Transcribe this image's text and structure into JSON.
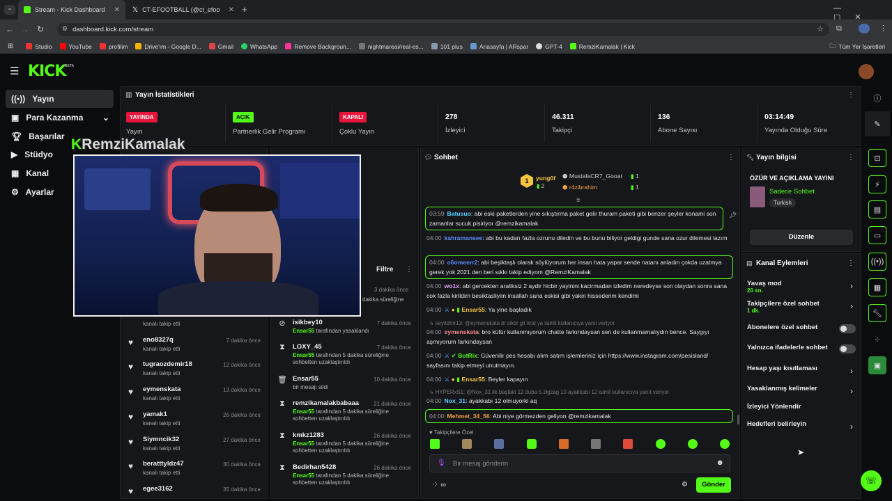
{
  "browser": {
    "tabs": [
      {
        "title": "Stream - Kick Dashboard",
        "icon": "kick-icon"
      },
      {
        "title": "CT-EFOOTBALL (@ct_efootball)",
        "icon": "x-icon"
      }
    ],
    "url": "dashboard.kick.com/stream",
    "bookmarks": [
      "Studio",
      "YouTube",
      "profilim",
      "Drive'ım - Google D...",
      "Gmail",
      "WhatsApp",
      "Remove Backgroun...",
      "nightmareai/real-es...",
      "101 plus",
      "Anasayfa | ARspar",
      "GPT-4",
      "RemziKamalak | Kick"
    ],
    "all_bookmarks": "Tüm Yer İşaretleri"
  },
  "brand": {
    "logo": "KICK",
    "beta": "BETA",
    "accent": "#53fc18"
  },
  "sidebar": {
    "items": [
      {
        "label": "Yayın",
        "icon": "broadcast-icon"
      },
      {
        "label": "Para Kazanma",
        "icon": "money-icon"
      },
      {
        "label": "Başarılar",
        "icon": "trophy-icon"
      },
      {
        "label": "Stüdyo",
        "icon": "camera-icon"
      },
      {
        "label": "Kanal",
        "icon": "tv-icon"
      },
      {
        "label": "Ayarlar",
        "icon": "gear-icon"
      }
    ]
  },
  "stats": {
    "title": "Yayın İstatistikleri",
    "cards": [
      {
        "badge": "YAYINDA",
        "label": "Yayın"
      },
      {
        "badge": "AÇIK",
        "label": "Partnerlik Gelir Programı"
      },
      {
        "badge": "KAPALI",
        "label": "Çoklu Yayın"
      },
      {
        "value": "278",
        "label": "İzleyici"
      },
      {
        "value": "46.311",
        "label": "Takipçi"
      },
      {
        "value": "136",
        "label": "Abone Sayısı"
      },
      {
        "value": "03:14:49",
        "label": "Yayında Olduğu Süre"
      }
    ]
  },
  "overlay": {
    "streamer": "RemziKamalak"
  },
  "followers": [
    {
      "name": "",
      "sub": "kanalı takip etti",
      "time": ""
    },
    {
      "name": "eno8327q",
      "sub": "kanalı takip etti",
      "time": "7 dakika önce"
    },
    {
      "name": "tugraozdemir18",
      "sub": "kanalı takip etti",
      "time": "12 dakika önce"
    },
    {
      "name": "eymenskata",
      "sub": "kanalı takip etti",
      "time": "13 dakika önce"
    },
    {
      "name": "yamak1",
      "sub": "kanalı takip etti",
      "time": "26 dakika önce"
    },
    {
      "name": "Siymncik32",
      "sub": "kanalı takip etti",
      "time": "27 dakika önce"
    },
    {
      "name": "beratttyldz47",
      "sub": "kanalı takip etti",
      "time": "30 dakika önce"
    },
    {
      "name": "egee3162",
      "sub": "",
      "time": "35 dakika önce"
    }
  ],
  "modlog": {
    "filter": "Filtre",
    "top": {
      "sub": "dakika süreliğine",
      "time": "3 dakika önce"
    },
    "rows": [
      {
        "icon": "ban-icon",
        "name": "isikbey10",
        "actor": "Ensar55",
        "action": "tarafından yasaklandı",
        "time": "7 dakika önce"
      },
      {
        "icon": "hourglass-icon",
        "name": "LOXY_45",
        "actor": "Ensar55",
        "action": "tarafından 5 dakika süreliğine sohbetten uzaklaştırıldı",
        "time": "7 dakika önce"
      },
      {
        "icon": "trash-icon",
        "name": "Ensar55",
        "actor": "",
        "action": "bir mesajı sildi",
        "time": "10 dakika önce"
      },
      {
        "icon": "hourglass-icon",
        "name": "remzikamalakbabaaa",
        "actor": "Ensar55",
        "action": "tarafından 5 dakika süreliğine sohbetten uzaklaştırıldı",
        "time": "21 dakika önce"
      },
      {
        "icon": "hourglass-icon",
        "name": "kmkz1283",
        "actor": "Ensar55",
        "action": "tarafından 5 dakika süreliğine sohbetten uzaklaştırıldı",
        "time": "26 dakika önce"
      },
      {
        "icon": "hourglass-icon",
        "name": "Bedirhan5428",
        "actor": "Ensar55",
        "action": "tarafından 5 dakika süreliğine sohbetten uzaklaştırıldı",
        "time": "26 dakika önce"
      }
    ]
  },
  "chat": {
    "title": "Sohbet",
    "leaders": [
      {
        "rank": "1",
        "name": "yung0f",
        "count": "2"
      },
      {
        "name": "MustafaCR7_Gooat",
        "count": "1"
      },
      {
        "name": "r4zibrahim",
        "count": "1"
      }
    ],
    "messages": [
      {
        "time": "03:59",
        "user": "Batusuo",
        "color": "#5bd1ff",
        "text": "abi eski paketlerden yine sıkıştırma paket gelir thuram paketi gibi benzer şeyler konami son zamanlar sucuk pisiriyor @remzikamalak",
        "hl": true
      },
      {
        "time": "04:00",
        "user": "kahramansee",
        "color": "#5b8cff",
        "text": "abi bu kadarı fazla ozrunu diledin ve bu bunu biliyor geldigi gunde sana ozur dilemesi lazım",
        "hl": false
      },
      {
        "time": "04:00",
        "user": "o6omeerr2",
        "color": "#5b8cff",
        "text": "abi beşiktaşlı olarak söylüyorum her insan hata yapar sende natanı anladın çokda uzatmya gerek yok 2021 den beri sıkkı takip ediyom @RemziKamalak",
        "hl": true
      },
      {
        "time": "04:00",
        "user": "wo1x",
        "color": "#e0a3ff",
        "text": "abi gercekten araliksiz 2 aydir hicbir yayinini kacirmadan izledim neredeyse son olaydan sonra sana cok fazla kirildim besiktasliyim insallah sana eskisi gibi yakin hissederim kendimi",
        "hl": false
      },
      {
        "time": "04:00",
        "user": "Ensar55",
        "color": "#f5c542",
        "text": "Ya yine başladık",
        "hl": false
      },
      {
        "reply": "seyitdmr13: @eymenskata bi siktir git kral ya isimli kullanıcıya yanıt veriyor"
      },
      {
        "time": "04:00",
        "user": "eymenskata",
        "color": "#ff8a8a",
        "text": "bro küfür kullanmıyorum chatte farkındaysan sen de kullanmamalıydın bence. Saygıyı aşmıyorum farkındaysan",
        "hl": false
      },
      {
        "time": "04:00",
        "user": "BotRix",
        "color": "#53fc18",
        "text": "Güvenilir pes hesabı alım satım işlemleriniz için https://www.instagram.com/pesisland/ sayfasını takip etmeyi unutmayın.",
        "hl": false
      },
      {
        "time": "04:00",
        "user": "Ensar55",
        "color": "#f5c542",
        "text": "Beyler kapayın",
        "hl": false
      },
      {
        "reply": "HYPERxS1: @Nox_31 ilk baştaki 12 duba 5 zigzag 10 ayakkabı 12 isimli kullanıcıya yanıt veriyor"
      },
      {
        "time": "04:00",
        "user": "Nox_31",
        "color": "#5bd1ff",
        "text": "ayakkabı 12 olmuyorki aq",
        "hl": false
      },
      {
        "time": "04:00",
        "user": "Mehmet_34_56",
        "color": "#f5a142",
        "text": "Abi niye görmezden geliyon @remzikamalak",
        "hl": true
      }
    ],
    "emote_label": "Takipçilere Özel",
    "input_placeholder": "Bir mesaj gönderin",
    "send": "Gönder"
  },
  "streaminfo": {
    "title": "Yayın bilgisi",
    "stream_title": "ÖZÜR VE AÇIKLAMA YAYINI",
    "category": "Sadece Sohbet",
    "tag": "Turkish",
    "edit": "Düzenle"
  },
  "channel_actions": {
    "title": "Kanal Eylemleri",
    "rows": [
      {
        "label": "Yavaş mod",
        "sub": "20 sn.",
        "kind": "chevron"
      },
      {
        "label": "Takipçilere özel sohbet",
        "sub": "1 dk.",
        "kind": "chevron"
      },
      {
        "label": "Abonelere özel sohbet",
        "sub": "",
        "kind": "toggle"
      },
      {
        "label": "Yalnızca ifadelerle sohbet",
        "sub": "",
        "kind": "toggle"
      },
      {
        "label": "Hesap yaşı kısıtlaması",
        "sub": "",
        "kind": "chevron"
      },
      {
        "label": "Yasaklanmış kelimeler",
        "sub": "",
        "kind": "chevron"
      },
      {
        "label": "İzleyici Yönlendir",
        "sub": "",
        "kind": "none"
      },
      {
        "label": "Hedefleri belirleyin",
        "sub": "",
        "kind": "chevron"
      }
    ]
  }
}
